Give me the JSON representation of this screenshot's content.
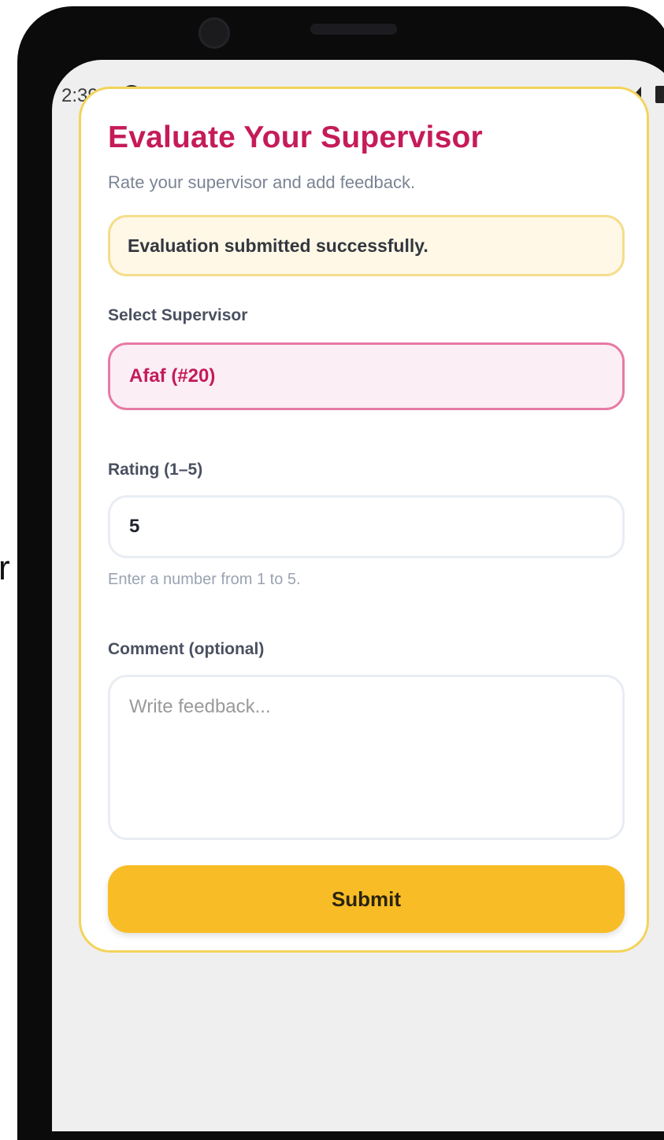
{
  "overlay": {
    "stray_text": "r"
  },
  "status_bar": {
    "time": "2:39",
    "icons": [
      "app-a-icon",
      "notification-icon",
      "dot-icon",
      "wifi-icon",
      "signal-icon",
      "battery-icon"
    ]
  },
  "form": {
    "title": "Evaluate Your Supervisor",
    "subtitle": "Rate your supervisor and add feedback.",
    "success_message": "Evaluation submitted successfully.",
    "supervisor_label": "Select Supervisor",
    "supervisor_value": "Afaf (#20)",
    "rating_label": "Rating (1–5)",
    "rating_value": "5",
    "rating_hint": "Enter a number from 1 to 5.",
    "comment_label": "Comment (optional)",
    "comment_placeholder": "Write feedback...",
    "submit_label": "Submit"
  },
  "colors": {
    "accent": "#c51b59",
    "card_border": "#f3d35a",
    "button": "#f8bd26",
    "banner_bg": "#fff8e6",
    "select_bg": "#fbeef4"
  }
}
